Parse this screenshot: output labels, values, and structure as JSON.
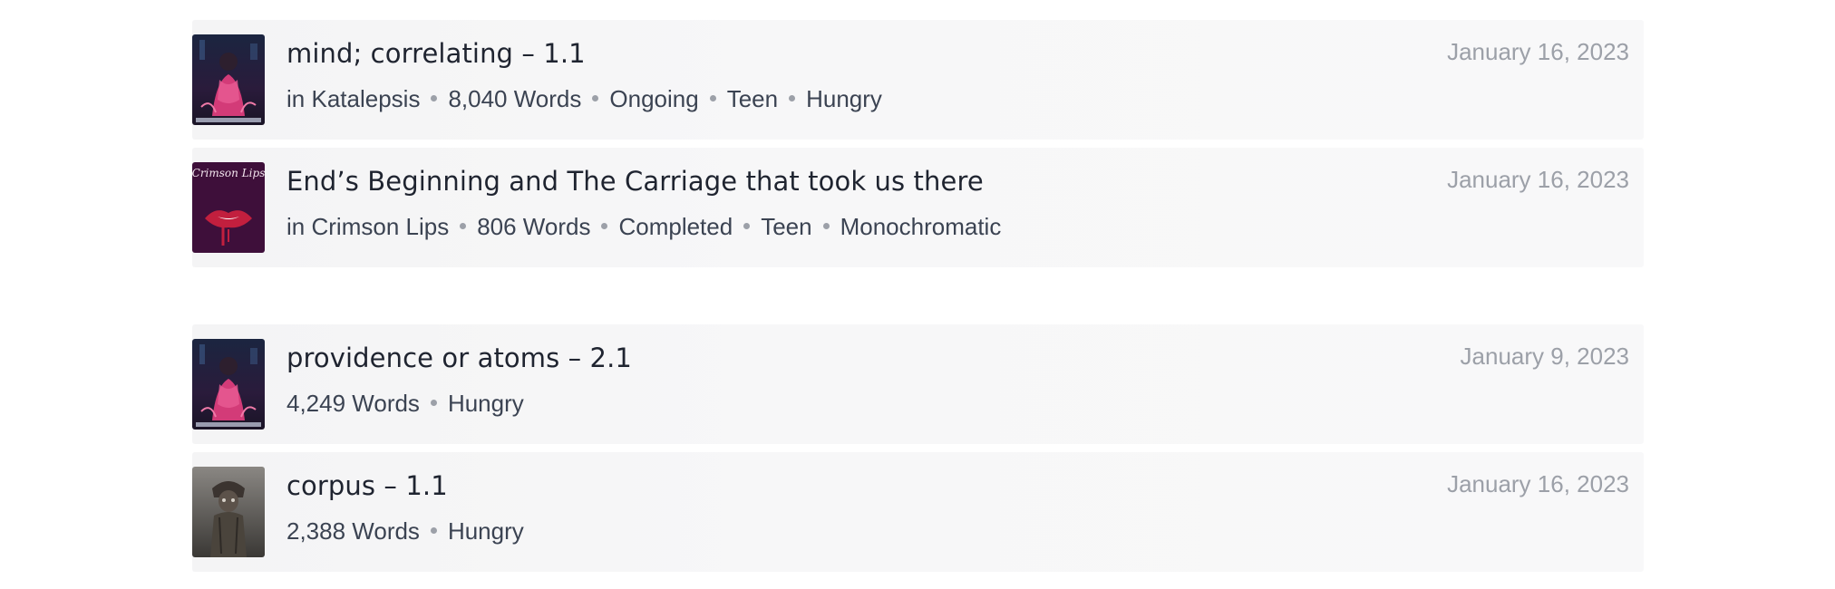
{
  "entries": [
    {
      "title": "mind; correlating – 1.1",
      "prefix": "in",
      "series": "Katalepsis",
      "words": "8,040 Words",
      "status": "Ongoing",
      "rating": "Teen",
      "tag": "Hungry",
      "date": "January 16, 2023",
      "cover_icon": "katalepsis-cover"
    },
    {
      "title": "End’s Beginning and The Carriage that took us there",
      "prefix": "in",
      "series": "Crimson Lips",
      "words": "806 Words",
      "status": "Completed",
      "rating": "Teen",
      "tag": "Monochromatic",
      "date": "January 16, 2023",
      "cover_icon": "crimson-lips-cover",
      "cover_text": "Crimson Lips"
    },
    {
      "title": "providence or atoms – 2.1",
      "words": "4,249 Words",
      "tag": "Hungry",
      "date": "January 9, 2023",
      "cover_icon": "katalepsis-cover"
    },
    {
      "title": "corpus – 1.1",
      "words": "2,388 Words",
      "tag": "Hungry",
      "date": "January 16, 2023",
      "cover_icon": "corpus-cover"
    }
  ],
  "colors": {
    "card_bg": "#f6f6f7",
    "title": "#1f2430",
    "meta": "#3b4352",
    "date": "#9ca0a8"
  }
}
